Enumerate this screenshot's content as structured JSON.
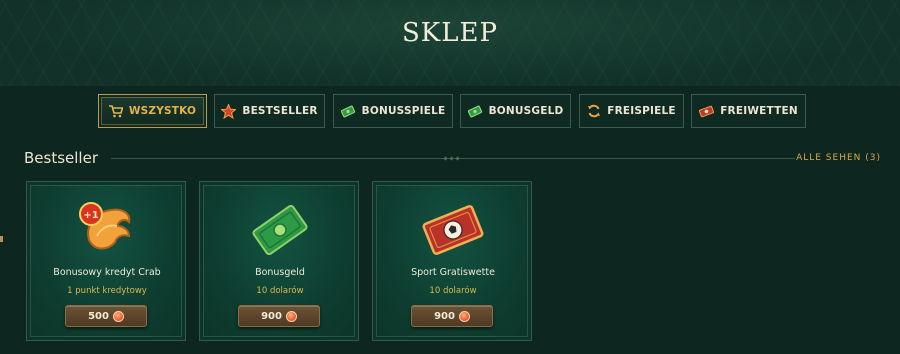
{
  "title": "SKLEP",
  "tabs": [
    {
      "label": "WSZYSTKO",
      "icon": "cart-icon",
      "active": true
    },
    {
      "label": "BESTSELLER",
      "icon": "star-icon",
      "active": false
    },
    {
      "label": "BONUSSPIELE",
      "icon": "cash-icon",
      "active": false
    },
    {
      "label": "BONUSGELD",
      "icon": "cash-icon",
      "active": false
    },
    {
      "label": "FREISPIELE",
      "icon": "refresh-icon",
      "active": false
    },
    {
      "label": "FREIWETTEN",
      "icon": "ticket-icon",
      "active": false
    }
  ],
  "section": {
    "title": "Bestseller",
    "see_all": "ALLE SEHEN (3)"
  },
  "cards": [
    {
      "name": "Bonusowy kredyt Crab",
      "sub": "1 punkt kredytowy",
      "price": "500",
      "icon": "crab-claw-icon",
      "badge": "+1"
    },
    {
      "name": "Bonusgeld",
      "sub": "10 dolarów",
      "price": "900",
      "icon": "cash-bill-icon"
    },
    {
      "name": "Sport Gratiswette",
      "sub": "10 dolarów",
      "price": "900",
      "icon": "football-ticket-icon"
    }
  ],
  "colors": {
    "background": "#0d2620",
    "accent_gold": "#e6b34a",
    "card_bg": "#0e3d30",
    "price_button": "#5e472d"
  }
}
